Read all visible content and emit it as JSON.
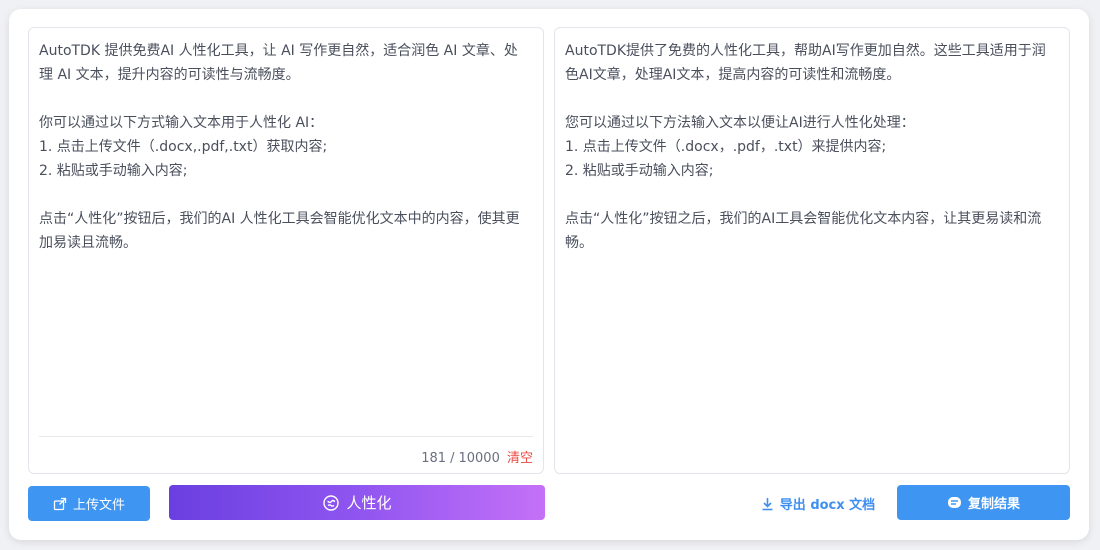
{
  "input_panel": {
    "lines": [
      "AutoTDK 提供免费AI 人性化工具，让 AI 写作更自然，适合润色 AI 文章、处理 AI 文本，提升内容的可读性与流畅度。",
      "",
      "你可以通过以下方式输入文本用于人性化 AI：",
      "1. 点击上传文件（.docx,.pdf,.txt）获取内容;",
      "2. 粘贴或手动输入内容;",
      "",
      "点击“人性化”按钮后，我们的AI 人性化工具会智能优化文本中的内容，使其更加易读且流畅。"
    ],
    "char_count": "181",
    "char_limit": "10000",
    "count_separator": "/",
    "clear_label": "清空"
  },
  "output_panel": {
    "lines": [
      "AutoTDK提供了免费的人性化工具，帮助AI写作更加自然。这些工具适用于润色AI文章，处理AI文本，提高内容的可读性和流畅度。",
      "",
      "您可以通过以下方法输入文本以便让AI进行人性化处理：",
      "1. 点击上传文件（.docx，.pdf，.txt）来提供内容;",
      "2. 粘贴或手动输入内容;",
      "",
      "点击“人性化”按钮之后，我们的AI工具会智能优化文本内容，让其更易读和流畅。"
    ]
  },
  "buttons": {
    "upload_label": "上传文件",
    "humanize_label": "人性化",
    "export_label": "导出 docx 文档",
    "copy_label": "复制结果"
  },
  "icons": {
    "upload": "upload-file-icon",
    "humanize": "brain-icon",
    "export": "download-icon",
    "copy": "copy-icon"
  },
  "colors": {
    "primary_blue": "#3f95f2",
    "gradient_start": "#6a3fe0",
    "gradient_end": "#c471f7",
    "clear_red": "#e84a43",
    "text": "#4a4f5c"
  }
}
